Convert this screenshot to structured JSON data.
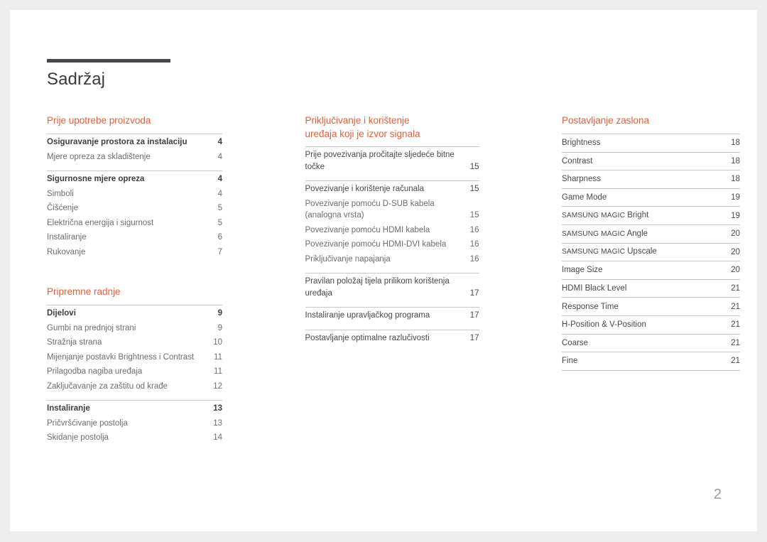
{
  "document": {
    "title": "Sadržaj",
    "page_number": "2",
    "accent_color": "#e0603c",
    "rule_color": "#474350"
  },
  "columns": [
    {
      "sections": [
        {
          "heading": "Prije upotrebe proizvoda",
          "groups": [
            {
              "rows": [
                {
                  "label": "Osiguravanje prostora za instalaciju",
                  "page": "4",
                  "style": "lead"
                },
                {
                  "label": "Mjere opreza za skladištenje",
                  "page": "4",
                  "style": "sub"
                }
              ]
            },
            {
              "rows": [
                {
                  "label": "Sigurnosne mjere opreza",
                  "page": "4",
                  "style": "lead"
                },
                {
                  "label": "Simboli",
                  "page": "4",
                  "style": "sub"
                },
                {
                  "label": "Čišćenje",
                  "page": "5",
                  "style": "sub"
                },
                {
                  "label": "Električna energija i sigurnost",
                  "page": "5",
                  "style": "sub"
                },
                {
                  "label": "Instaliranje",
                  "page": "6",
                  "style": "sub"
                },
                {
                  "label": "Rukovanje",
                  "page": "7",
                  "style": "sub"
                }
              ]
            }
          ]
        },
        {
          "heading": "Pripremne radnje",
          "groups": [
            {
              "rows": [
                {
                  "label": "Dijelovi",
                  "page": "9",
                  "style": "lead"
                },
                {
                  "label": "Gumbi na prednjoj strani",
                  "page": "9",
                  "style": "sub"
                },
                {
                  "label": "Stražnja strana",
                  "page": "10",
                  "style": "sub"
                },
                {
                  "label": "Mijenjanje postavki Brightness i Contrast",
                  "page": "11",
                  "style": "sub"
                },
                {
                  "label": "Prilagodba nagiba uređaja",
                  "page": "11",
                  "style": "sub"
                },
                {
                  "label": "Zaključavanje za zaštitu od krađe",
                  "page": "12",
                  "style": "sub"
                }
              ]
            },
            {
              "rows": [
                {
                  "label": "Instaliranje",
                  "page": "13",
                  "style": "lead"
                },
                {
                  "label": "Pričvršćivanje postolja",
                  "page": "13",
                  "style": "sub"
                },
                {
                  "label": "Skidanje postolja",
                  "page": "14",
                  "style": "sub"
                }
              ]
            }
          ]
        }
      ]
    },
    {
      "sections": [
        {
          "heading": "Priključivanje i korištenje\nuređaja koji je izvor signala",
          "two_line": true,
          "groups": [
            {
              "rows": [
                {
                  "label": "Prije povezivanja pročitajte sljedeće bitne točke",
                  "page": "15",
                  "style": "plain"
                }
              ]
            },
            {
              "rows": [
                {
                  "label": "Povezivanje i korištenje računala",
                  "page": "15",
                  "style": "plain"
                },
                {
                  "label": "Povezivanje pomoću D-SUB kabela (analogna vrsta)",
                  "page": "15",
                  "style": "sub"
                },
                {
                  "label": "Povezivanje pomoću HDMI kabela",
                  "page": "16",
                  "style": "sub"
                },
                {
                  "label": "Povezivanje pomoću HDMI-DVI kabela",
                  "page": "16",
                  "style": "sub"
                },
                {
                  "label": "Priključivanje napajanja",
                  "page": "16",
                  "style": "sub"
                }
              ]
            },
            {
              "rows": [
                {
                  "label": "Pravilan položaj tijela prilikom korištenja uređaja",
                  "page": "17",
                  "style": "plain"
                }
              ]
            },
            {
              "rows": [
                {
                  "label": "Instaliranje upravljačkog programa",
                  "page": "17",
                  "style": "plain"
                }
              ]
            },
            {
              "rows": [
                {
                  "label": "Postavljanje optimalne razlučivosti",
                  "page": "17",
                  "style": "plain"
                }
              ]
            }
          ]
        }
      ]
    },
    {
      "sections": [
        {
          "heading": "Postavljanje zaslona",
          "ruled": true,
          "rows": [
            {
              "label": "Brightness",
              "page": "18"
            },
            {
              "label": "Contrast",
              "page": "18"
            },
            {
              "label": "Sharpness",
              "page": "18"
            },
            {
              "label": "Game Mode",
              "page": "19"
            },
            {
              "label": "SAMSUNG MAGIC Bright",
              "page": "19",
              "smallcaps_prefix": "SAMSUNG MAGIC",
              "rest": " Bright"
            },
            {
              "label": "SAMSUNG MAGIC Angle",
              "page": "20",
              "smallcaps_prefix": "SAMSUNG MAGIC",
              "rest": " Angle"
            },
            {
              "label": "SAMSUNG MAGIC Upscale",
              "page": "20",
              "smallcaps_prefix": "SAMSUNG MAGIC",
              "rest": " Upscale"
            },
            {
              "label": "Image Size",
              "page": "20"
            },
            {
              "label": "HDMI Black Level",
              "page": "21"
            },
            {
              "label": "Response Time",
              "page": "21"
            },
            {
              "label": "H-Position & V-Position",
              "page": "21"
            },
            {
              "label": "Coarse",
              "page": "21"
            },
            {
              "label": "Fine",
              "page": "21"
            }
          ]
        }
      ]
    }
  ]
}
